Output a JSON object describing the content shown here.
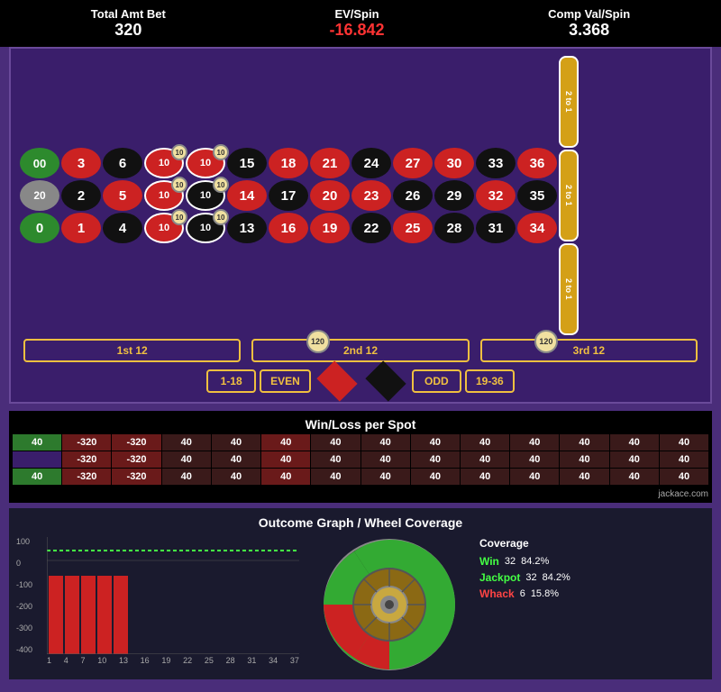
{
  "header": {
    "total_amt_bet_label": "Total Amt Bet",
    "total_amt_bet_value": "320",
    "ev_spin_label": "EV/Spin",
    "ev_spin_value": "-16.842",
    "comp_val_spin_label": "Comp Val/Spin",
    "comp_val_spin_value": "3.368"
  },
  "roulette": {
    "green_numbers": [
      "00",
      "0"
    ],
    "row1": [
      "3",
      "6",
      "10",
      "10",
      "15",
      "18",
      "21",
      "24",
      "27",
      "30",
      "33",
      "36"
    ],
    "row2": [
      "2",
      "5",
      "10",
      "10",
      "14",
      "17",
      "20",
      "23",
      "26",
      "29",
      "32",
      "35"
    ],
    "row3": [
      "1",
      "4",
      "10",
      "10",
      "13",
      "16",
      "19",
      "22",
      "25",
      "28",
      "31",
      "34"
    ],
    "row1_colors": [
      "red",
      "black",
      "chip",
      "chip",
      "black",
      "red",
      "red",
      "black",
      "red",
      "red",
      "black",
      "red"
    ],
    "row2_colors": [
      "black",
      "red",
      "chip",
      "chip",
      "red",
      "black",
      "red",
      "black",
      "black",
      "black",
      "red",
      "black"
    ],
    "row3_colors": [
      "red",
      "black",
      "chip",
      "chip",
      "black",
      "red",
      "red",
      "black",
      "red",
      "black",
      "black",
      "red"
    ],
    "two_to_one": "2 to 1",
    "first12": "1st 12",
    "second12": "2nd 12",
    "third12": "3rd 12",
    "bet118": "1-18",
    "even": "EVEN",
    "odd": "ODD",
    "bet1936": "19-36",
    "chip120_1": "120",
    "chip120_2": "120"
  },
  "winloss": {
    "title": "Win/Loss per Spot",
    "row1": [
      "40",
      "-320",
      "-320",
      "40",
      "40",
      "40",
      "40",
      "40",
      "40",
      "40",
      "40",
      "40",
      "40",
      "40"
    ],
    "row2": [
      "",
      "-320",
      "-320",
      "40",
      "40",
      "40",
      "40",
      "40",
      "40",
      "40",
      "40",
      "40",
      "40",
      "40"
    ],
    "row3": [
      "40",
      "-320",
      "-320",
      "40",
      "40",
      "40",
      "40",
      "40",
      "40",
      "40",
      "40",
      "40",
      "40",
      "40"
    ]
  },
  "graph": {
    "title": "Outcome Graph / Wheel Coverage",
    "y_labels": [
      "100",
      "0",
      "-100",
      "-200",
      "-300",
      "-400"
    ],
    "x_labels": [
      "1",
      "4",
      "7",
      "10",
      "13",
      "16",
      "19",
      "22",
      "25",
      "28",
      "31",
      "34",
      "37"
    ],
    "coverage_title": "Coverage",
    "win_label": "Win",
    "win_count": "32",
    "win_pct": "84.2%",
    "jackpot_label": "Jackpot",
    "jackpot_count": "32",
    "jackpot_pct": "84.2%",
    "whack_label": "Whack",
    "whack_count": "6",
    "whack_pct": "15.8%",
    "brand": "jackace.com"
  }
}
